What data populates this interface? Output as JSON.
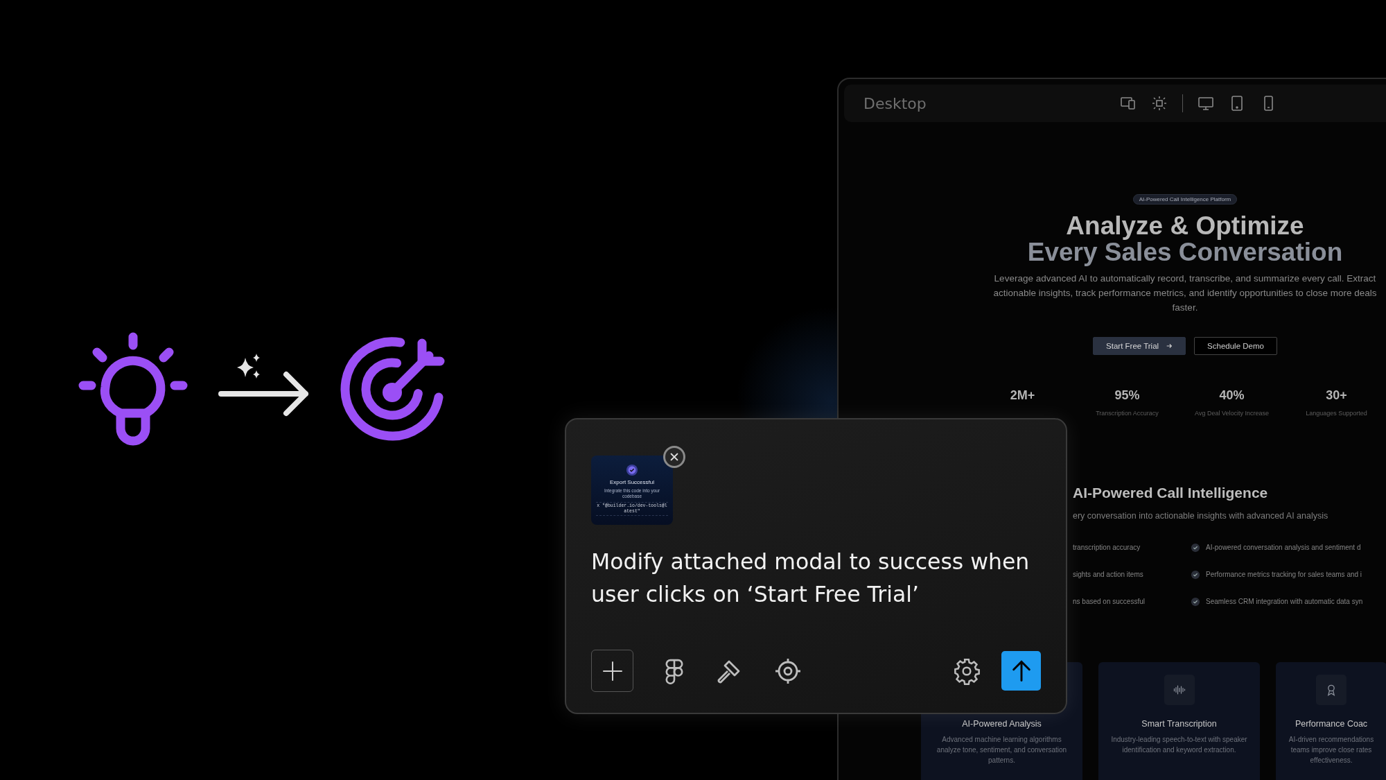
{
  "preview_window": {
    "title": "Desktop",
    "page": {
      "badge": "AI-Powered Call Intelligence Platform",
      "headline": [
        "Analyze & Optimize",
        "Every Sales Conversation"
      ],
      "intro": "Leverage advanced AI to automatically record, transcribe, and summarize every call. Extract actionable insights, track performance metrics, and identify opportunities to close more deals faster.",
      "buttons": [
        {
          "label": "Start Free Trial",
          "kind": "primary"
        },
        {
          "label": "Schedule Demo",
          "kind": "outline"
        }
      ],
      "stats": [
        {
          "value": "2M+"
        },
        {
          "value": "95%",
          "label": "Transcription Accuracy"
        },
        {
          "value": "40%",
          "label": "Avg Deal Velocity Increase"
        },
        {
          "value": "30+",
          "label": "Languages Supported"
        }
      ],
      "section": {
        "title": "AI-Powered Call Intelligence",
        "subtitle": "ery conversation into actionable insights with advanced AI analysis",
        "features_left": [
          "transcription accuracy",
          "sights and action items",
          "ns based on successful"
        ],
        "features_right": [
          "AI-powered conversation analysis and sentiment d",
          "Performance metrics tracking for sales teams and i",
          "Seamless CRM integration with automatic data syn"
        ]
      },
      "cards": [
        {
          "kind": "covered",
          "title": "AI-Powered Analysis",
          "description": "Advanced machine learning algorithms analyze tone, sentiment, and conversation patterns."
        },
        {
          "kind": "waveform",
          "title": "Smart Transcription",
          "description": "Industry-leading speech-to-text with speaker identification and keyword extraction."
        },
        {
          "kind": "award",
          "title": "Performance Coac",
          "description": "AI-driven recommendations teams improve close rates effectiveness."
        }
      ]
    }
  },
  "prompt_card": {
    "attachment": {
      "title": "Export Successful",
      "subtitle": "Integrate this code into your codebase",
      "code": "x \"@builder.io/dev-tools@latest\""
    },
    "text": "Modify attached modal to success when user clicks on ‘Start Free Trial’"
  }
}
